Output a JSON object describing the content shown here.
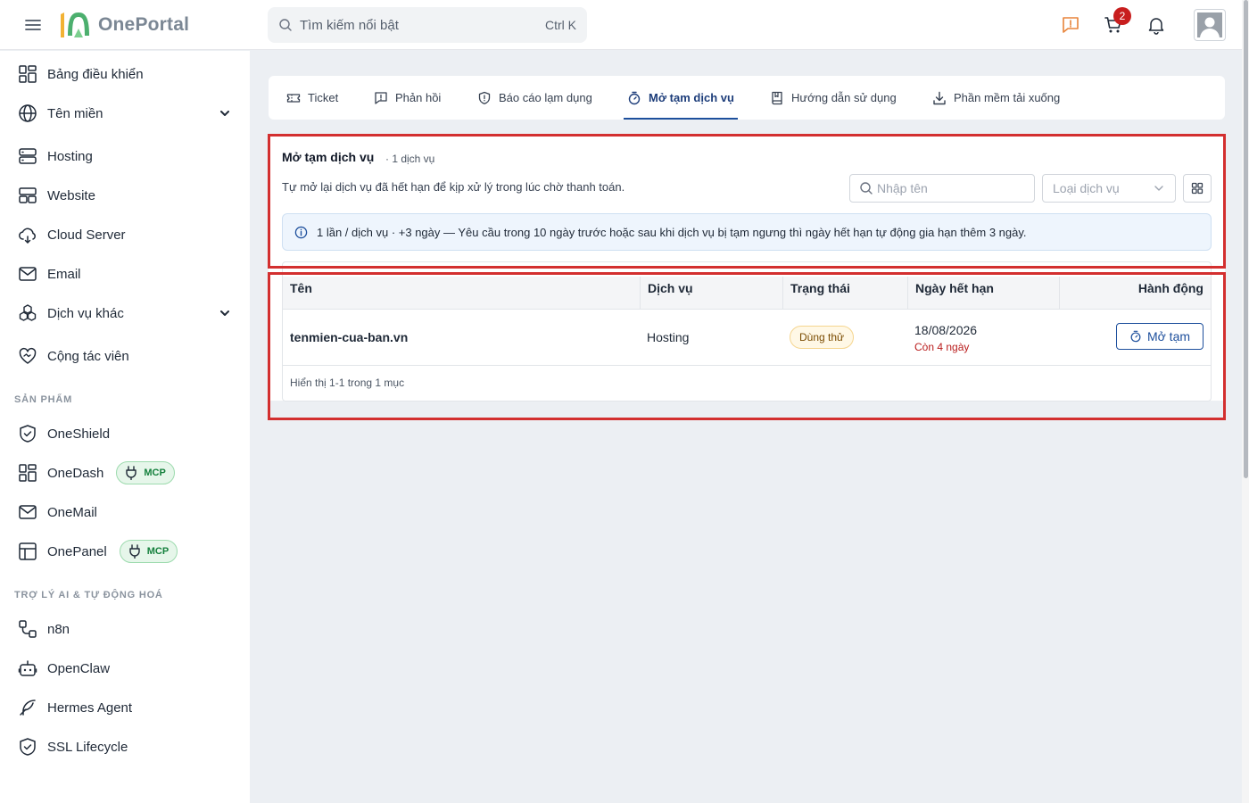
{
  "header": {
    "logo_text": "OnePortal",
    "search_placeholder": "Tìm kiếm nổi bật",
    "search_shortcut": "Ctrl K",
    "cart_count": "2",
    "colors": {
      "feedback_icon": "#e8843a",
      "badge": "#c81e1e"
    }
  },
  "sidebar": {
    "items": [
      {
        "label": "Bảng điều khiển",
        "icon": "dashboard-icon"
      },
      {
        "label": "Tên miền",
        "icon": "globe-icon",
        "expandable": true
      },
      {
        "label": "Hosting",
        "icon": "server-icon"
      },
      {
        "label": "Website",
        "icon": "layout-icon"
      },
      {
        "label": "Cloud Server",
        "icon": "cloud-icon"
      },
      {
        "label": "Email",
        "icon": "mail-icon"
      },
      {
        "label": "Dịch vụ khác",
        "icon": "boxes-icon",
        "expandable": true
      },
      {
        "label": "Cộng tác viên",
        "icon": "handshake-heart-icon"
      }
    ],
    "section_products": "SẢN PHẨM",
    "products": [
      {
        "label": "OneShield",
        "icon": "shield-icon"
      },
      {
        "label": "OneDash",
        "icon": "dashboard-icon",
        "badge": "MCP"
      },
      {
        "label": "OneMail",
        "icon": "mail-icon"
      },
      {
        "label": "OnePanel",
        "icon": "panel-icon",
        "badge": "MCP"
      }
    ],
    "section_ai": "TRỢ LÝ AI & TỰ ĐỘNG HOÁ",
    "ai": [
      {
        "label": "n8n",
        "icon": "workflow-icon"
      },
      {
        "label": "OpenClaw",
        "icon": "robot-icon"
      },
      {
        "label": "Hermes Agent",
        "icon": "feather-icon"
      },
      {
        "label": "SSL Lifecycle",
        "icon": "shield-check-icon"
      }
    ]
  },
  "tabs": [
    {
      "label": "Ticket",
      "icon": "ticket-icon"
    },
    {
      "label": "Phản hồi",
      "icon": "feedback-icon"
    },
    {
      "label": "Báo cáo lạm dụng",
      "icon": "shield-alert-icon"
    },
    {
      "label": "Mở tạm dịch vụ",
      "icon": "timer-icon",
      "active": true
    },
    {
      "label": "Hướng dẫn sử dụng",
      "icon": "book-icon"
    },
    {
      "label": "Phần mềm tải xuống",
      "icon": "download-icon"
    }
  ],
  "panel": {
    "title": "Mở tạm dịch vụ",
    "count": "· 1 dịch vụ",
    "description": "Tự mở lại dịch vụ đã hết hạn để kịp xử lý trong lúc chờ thanh toán.",
    "name_placeholder": "Nhập tên",
    "type_placeholder": "Loại dịch vụ",
    "info": "1 lần / dịch vụ · +3 ngày — Yêu cầu trong 10 ngày trước hoặc sau khi dịch vụ bị tạm ngưng thì ngày hết hạn tự động gia hạn thêm 3 ngày."
  },
  "table": {
    "columns": [
      "Tên",
      "Dịch vụ",
      "Trạng thái",
      "Ngày hết hạn",
      "Hành động"
    ],
    "rows": [
      {
        "name": "tenmien-cua-ban.vn",
        "service": "Hosting",
        "status": "Dùng thử",
        "expiry": "18/08/2026",
        "remaining": "Còn 4 ngày",
        "action": "Mở tạm"
      }
    ],
    "footer": "Hiển thị 1-1 trong 1 mục"
  }
}
